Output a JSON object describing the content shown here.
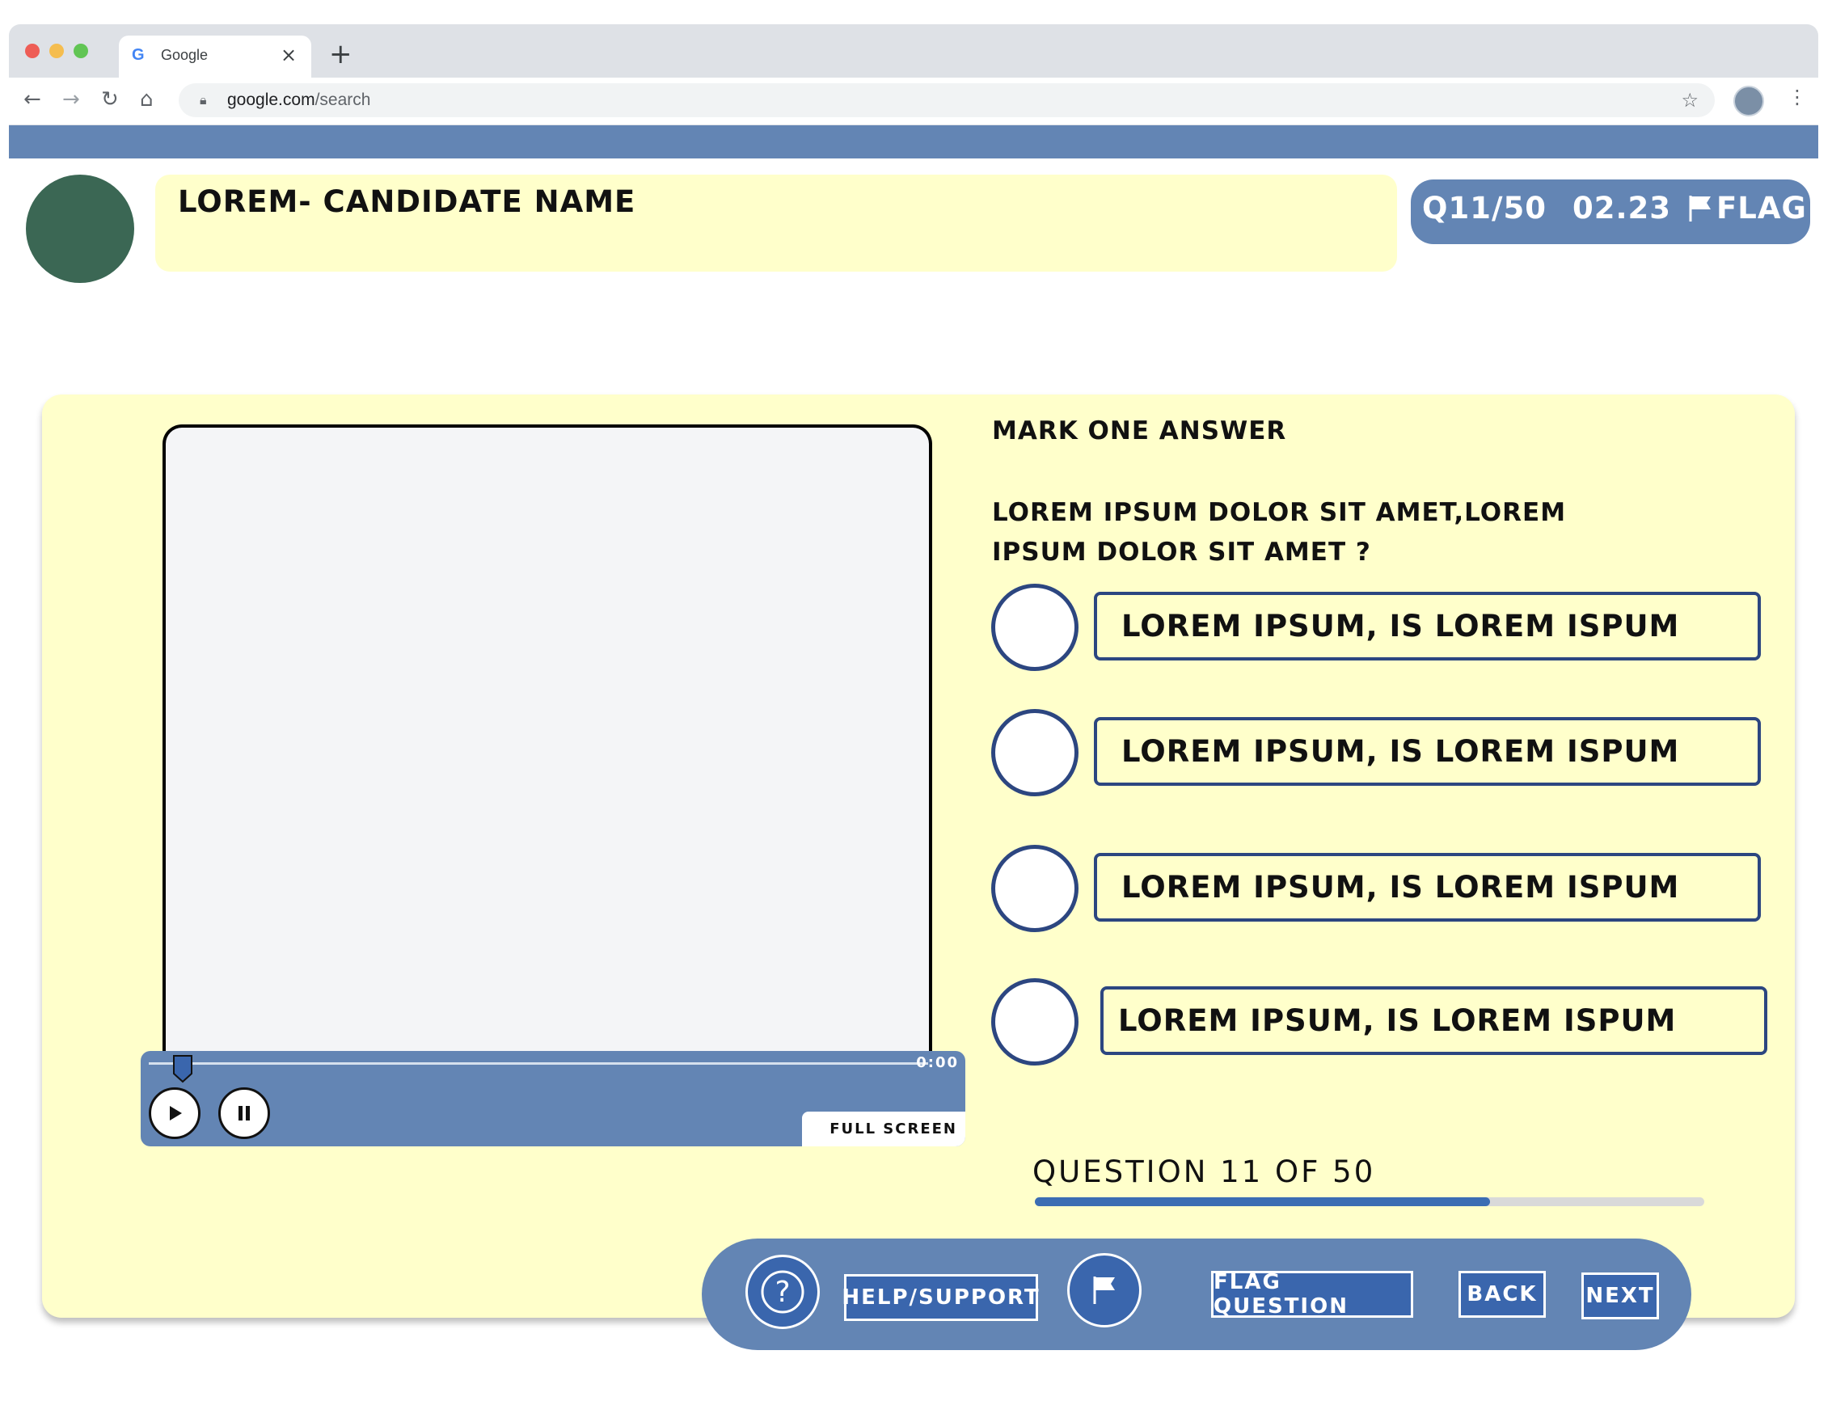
{
  "browser": {
    "tab_title": "Google",
    "tab_favicon": "G",
    "url_host": "google.com",
    "url_path": "/search",
    "icons": [
      "back-icon",
      "forward-icon",
      "reload-icon",
      "home-icon",
      "lock-icon",
      "star-icon",
      "profile-avatar",
      "kebab-menu-icon",
      "close-icon",
      "new-tab-icon"
    ]
  },
  "header": {
    "candidate_name": "LOREM- CANDIDATE NAME",
    "question_counter": "Q11/50",
    "timer": "02.23",
    "flag_label": "FLAG"
  },
  "player": {
    "time": "0:00",
    "fullscreen_label": "FULL SCREEN",
    "scrub_position": 0.03
  },
  "question": {
    "instruction": "MARK ONE ANSWER",
    "text": "LOREM IPSUM DOLOR SIT AMET,LOREM IPSUM DOLOR SIT AMET ?",
    "options": [
      "LOREM IPSUM, IS LOREM ISPUM",
      "LOREM IPSUM, IS LOREM ISPUM",
      "LOREM IPSUM, IS LOREM ISPUM",
      "LOREM IPSUM, IS LOREM ISPUM"
    ]
  },
  "progress": {
    "label": "QUESTION 11 OF 50",
    "fraction": 0.68
  },
  "footer": {
    "help_label": "HELP/SUPPORT",
    "flag_question_label": "FLAG QUESTION",
    "back_label": "BACK",
    "next_label": "NEXT"
  },
  "colors": {
    "accent_blue": "#6385b4",
    "dark_blue": "#2c4680",
    "button_blue": "#3a66ad",
    "card_yellow": "#ffffcb",
    "avatar_green": "#3b6754"
  }
}
